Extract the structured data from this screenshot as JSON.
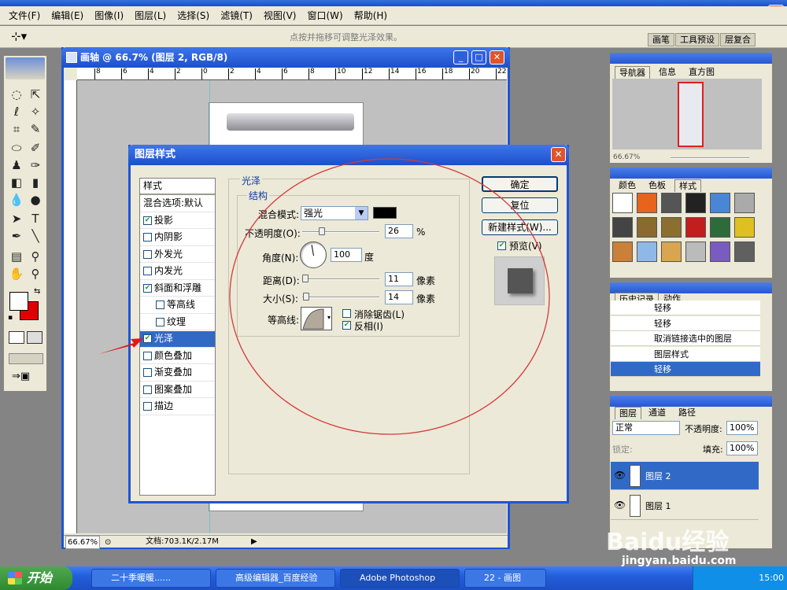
{
  "app": {
    "title": "Adobe Photoshop"
  },
  "menu": [
    "文件(F)",
    "编辑(E)",
    "图像(I)",
    "图层(L)",
    "选择(S)",
    "滤镜(T)",
    "视图(V)",
    "窗口(W)",
    "帮助(H)"
  ],
  "options_bar": {
    "hint": "点按并拖移可调整光泽效果。",
    "wells": [
      "画笔",
      "工具预设",
      "层复合"
    ]
  },
  "document": {
    "title": "画轴 @ 66.7% (图层 2, RGB/8)",
    "ruler_labels": [
      "8",
      "6",
      "4",
      "2",
      "0",
      "2",
      "4",
      "6",
      "8",
      "10",
      "12",
      "14",
      "16",
      "18",
      "20",
      "22"
    ],
    "zoom": "66.67%",
    "doc_info": "文档:703.1K/2.17M"
  },
  "dialog": {
    "title": "图层样式",
    "styles_header": "样式",
    "blend_options": "混合选项:默认",
    "effects": [
      {
        "label": "投影",
        "checked": true
      },
      {
        "label": "内阴影",
        "checked": false
      },
      {
        "label": "外发光",
        "checked": false
      },
      {
        "label": "内发光",
        "checked": false
      },
      {
        "label": "斜面和浮雕",
        "checked": true
      },
      {
        "label": "等高线",
        "checked": false
      },
      {
        "label": "纹理",
        "checked": false
      },
      {
        "label": "光泽",
        "checked": true
      },
      {
        "label": "颜色叠加",
        "checked": false
      },
      {
        "label": "渐变叠加",
        "checked": false
      },
      {
        "label": "图案叠加",
        "checked": false
      },
      {
        "label": "描边",
        "checked": false
      }
    ],
    "section_title": "光泽",
    "group_title": "结构",
    "blend_mode_label": "混合模式:",
    "blend_mode_value": "强光",
    "opacity_label": "不透明度(O):",
    "opacity_value": "26",
    "opacity_unit": "%",
    "angle_label": "角度(N):",
    "angle_value": "100",
    "angle_unit": "度",
    "distance_label": "距离(D):",
    "distance_value": "11",
    "size_label": "大小(S):",
    "size_value": "14",
    "px_unit": "像素",
    "contour_label": "等高线:",
    "antialias_label": "消除锯齿(L)",
    "antialias_checked": false,
    "invert_label": "反相(I)",
    "invert_checked": true,
    "ok_label": "确定",
    "reset_label": "复位",
    "new_style_label": "新建样式(W)...",
    "preview_label": "预览(V)",
    "preview_checked": true,
    "sliders": {
      "opacity": 26,
      "distance": 11,
      "size": 14
    },
    "colors": {
      "gloss_color": "#000000",
      "accent": "#1f54d6",
      "selection": "#3169c6"
    }
  },
  "navigator": {
    "tabs": [
      "导航器",
      "信息",
      "直方图"
    ],
    "zoom": "66.67%"
  },
  "swatches": {
    "tabs": [
      "颜色",
      "色板",
      "样式"
    ]
  },
  "history": {
    "tabs": [
      "历史记录",
      "动作"
    ],
    "items": [
      {
        "label": "轻移",
        "selected": false
      },
      {
        "label": "轻移",
        "selected": false
      },
      {
        "label": "取消链接选中的图层",
        "selected": false
      },
      {
        "label": "图层样式",
        "selected": false
      },
      {
        "label": "轻移",
        "selected": true
      }
    ]
  },
  "layers": {
    "tabs": [
      "图层",
      "通道",
      "路径"
    ],
    "blend_mode": "正常",
    "opacity_label": "不透明度:",
    "opacity_value": "100%",
    "lock_label": "锁定:",
    "fill_label": "填充:",
    "fill_value": "100%",
    "items": [
      {
        "name": "图层 2",
        "selected": true
      },
      {
        "name": "图层 1",
        "selected": false
      }
    ]
  },
  "taskbar": {
    "start_label": "开始",
    "tasks": [
      "二十季暖暖......",
      "高级编辑器_百度经验",
      "Adobe Photoshop",
      "22 - 画图"
    ],
    "clock": "15:00"
  },
  "watermark": {
    "text": "Baidu经验",
    "url": "jingyan.baidu.com"
  }
}
